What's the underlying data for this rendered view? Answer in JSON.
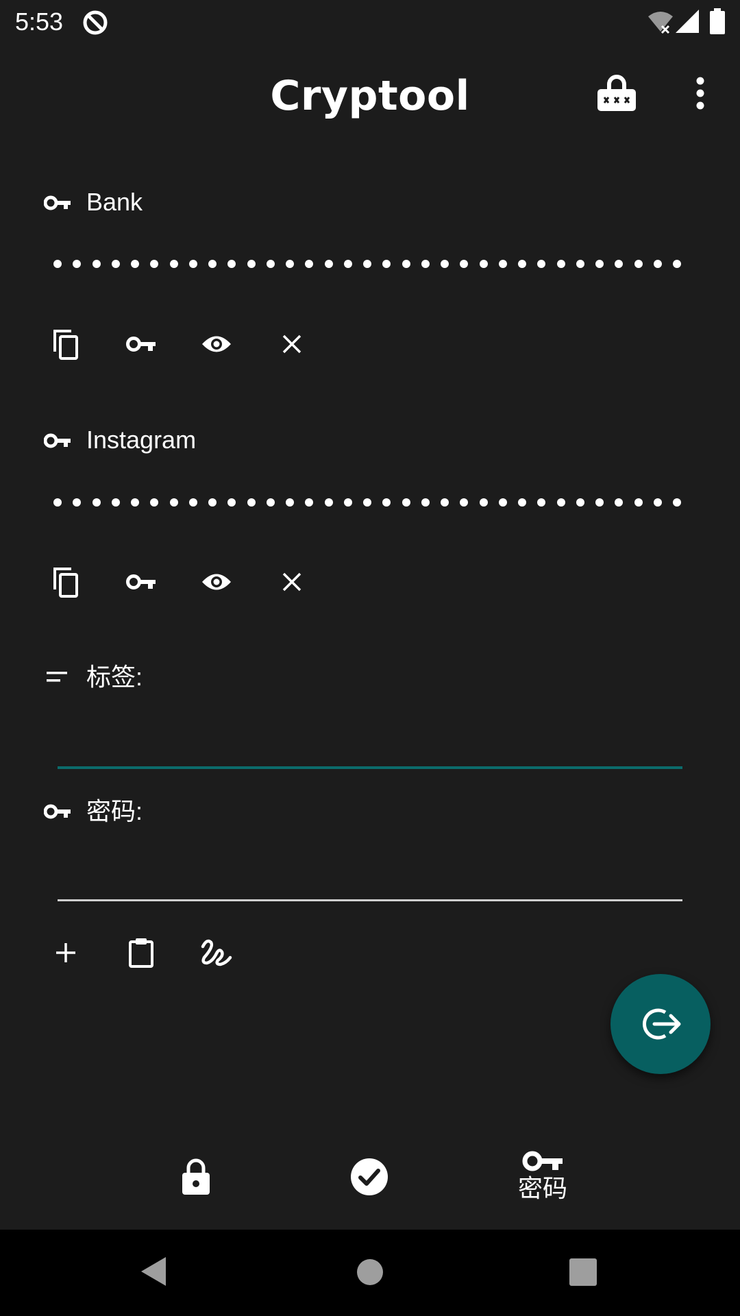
{
  "status_bar": {
    "time": "5:53"
  },
  "app_bar": {
    "title": "Cryptool",
    "icons": [
      "password-lock-icon",
      "more-vert-icon"
    ]
  },
  "entries": [
    {
      "label": "Bank",
      "masked_dot_count": 33,
      "actions": [
        "copy-icon",
        "key-icon",
        "visibility-icon",
        "close-icon"
      ]
    },
    {
      "label": "Instagram",
      "masked_dot_count": 33,
      "actions": [
        "copy-icon",
        "key-icon",
        "visibility-icon",
        "close-icon"
      ]
    }
  ],
  "form": {
    "label_field": {
      "label": "标签:",
      "value": "",
      "focused": true
    },
    "password_field": {
      "label": "密码:",
      "value": ""
    },
    "actions": [
      "add-icon",
      "clipboard-icon",
      "signature-icon"
    ]
  },
  "fab": {
    "icon": "logout-icon"
  },
  "bottom_nav": {
    "items": [
      {
        "icon": "lock-icon",
        "label": ""
      },
      {
        "icon": "check-circle-icon",
        "label": ""
      },
      {
        "icon": "key-icon",
        "label": "密码",
        "selected": true
      }
    ]
  },
  "colors": {
    "background": "#1c1c1c",
    "accent": "#075f60",
    "focus_underline": "#0b6b6b",
    "text": "#ffffff"
  }
}
